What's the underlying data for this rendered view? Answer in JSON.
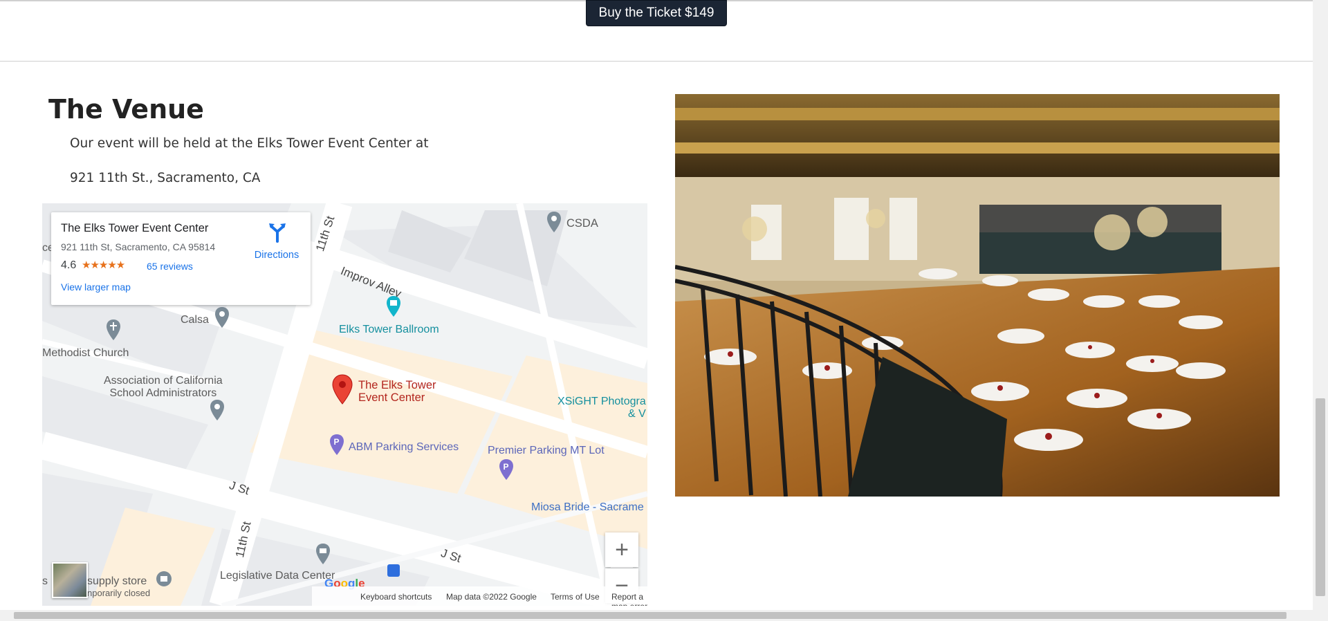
{
  "buy_button": "Buy the Ticket $149",
  "venue": {
    "title": "The Venue",
    "line1": "Our event will be held at the Elks Tower Event Center at",
    "line2": "921 11th St., Sacramento, CA"
  },
  "map": {
    "card": {
      "title": "The Elks Tower Event Center",
      "address": "921 11th St, Sacramento, CA 95814",
      "rating": "4.6",
      "stars": "★★★★★",
      "reviews": "65 reviews",
      "larger_map": "View larger map",
      "directions": "Directions"
    },
    "labels": {
      "csda": "CSDA",
      "improv_alley": "Improv Alley",
      "calsa": "Calsa",
      "methodist": "Methodist Church",
      "elks_ballroom": "Elks Tower Ballroom",
      "acsa": "Association of California\nSchool Administrators",
      "elks_pin": "The Elks Tower\nEvent Center",
      "xsight": "XSiGHT Photogra\n& V",
      "abm": "ABM Parking Services",
      "premier": "Premier Parking MT Lot",
      "miosa": "Miosa Bride - Sacrame",
      "j_st_1": "J St",
      "j_st_2": "J St",
      "eleventh_1": "11th St",
      "eleventh_2": "11th St",
      "legislative": "Legislative Data Center",
      "supply": "supply store",
      "temp_closed": "nporarily closed",
      "edge_ce": "ce",
      "edge_s": "s"
    },
    "google": "Google",
    "footer": {
      "shortcuts": "Keyboard shortcuts",
      "map_data": "Map data ©2022 Google",
      "terms": "Terms of Use",
      "report": "Report a map error"
    },
    "zoom_in": "+",
    "zoom_out": "−"
  },
  "icons": [
    "directions-icon",
    "map-pin-icon",
    "parking-icon",
    "church-icon",
    "ticket-icon",
    "bus-icon",
    "store-icon",
    "government-icon"
  ]
}
